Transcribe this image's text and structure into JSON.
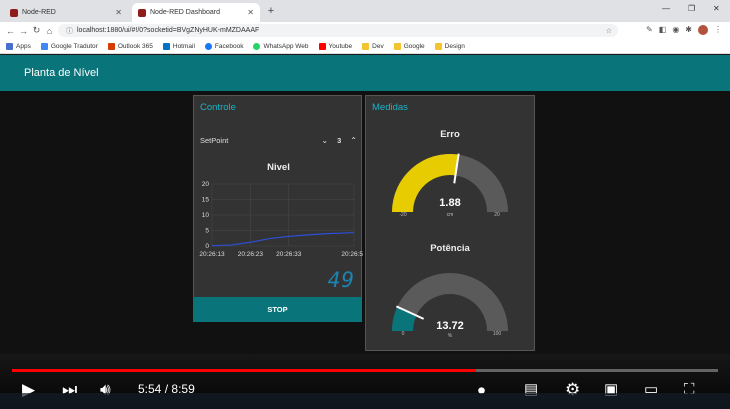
{
  "browser": {
    "tabs": [
      {
        "title": "Node-RED",
        "close": "✕"
      },
      {
        "title": "Node-RED Dashboard",
        "close": "✕"
      }
    ],
    "new_tab": "+",
    "window_controls": [
      "—",
      "❐",
      "✕"
    ],
    "url": "localhost:1880/ui/#!/0?socketid=BVgZNyHUK-mMZDAAAF",
    "bookmarks": [
      {
        "label": "Apps",
        "color": "#4a6fd1"
      },
      {
        "label": "Google Tradutor",
        "color": "#4285f4"
      },
      {
        "label": "Outlook 365",
        "color": "#d83b01"
      },
      {
        "label": "Hotmail",
        "color": "#0072c6"
      },
      {
        "label": "Facebook",
        "color": "#1877f2"
      },
      {
        "label": "WhatsApp Web",
        "color": "#25d366"
      },
      {
        "label": "Youtube",
        "color": "#ff0000"
      },
      {
        "label": "Dev",
        "color": "#f4c430"
      },
      {
        "label": "Google",
        "color": "#f4c430"
      },
      {
        "label": "Design",
        "color": "#f4c430"
      }
    ]
  },
  "dashboard": {
    "header_title": "Planta de Nível",
    "controle": {
      "title": "Controle",
      "setpoint_label": "SetPoint",
      "setpoint_value": "3",
      "down_icon": "⌄",
      "up_icon": "⌃",
      "stop_label": "STOP"
    },
    "medidas": {
      "title": "Medidas",
      "erro": {
        "title": "Erro",
        "value": "1.88",
        "units": "cm",
        "min": "-20",
        "max": "20",
        "color": "#e6cc00"
      },
      "potencia": {
        "title": "Potência",
        "value": "13.72",
        "units": "%",
        "min": "0",
        "max": "100",
        "color": "#097479"
      }
    },
    "lcd_display": "49"
  },
  "chart_data": {
    "type": "line",
    "title": "Nivel",
    "xlabel": "",
    "ylabel": "",
    "ylim": [
      0,
      20
    ],
    "y_ticks": [
      "20",
      "15",
      "10",
      "5",
      "0"
    ],
    "x_ticks": [
      "20:26:13",
      "20:26:23",
      "20:26:33",
      "20:26:50"
    ],
    "series": [
      {
        "color": "#2b4fd6",
        "x": [
          "20:26:13",
          "20:26:18",
          "20:26:23",
          "20:26:28",
          "20:26:33",
          "20:26:38",
          "20:26:43",
          "20:26:50"
        ],
        "values": [
          0.1,
          0.3,
          1.2,
          2.4,
          3.1,
          3.6,
          4.0,
          4.3
        ]
      }
    ],
    "grid": true
  },
  "player": {
    "current_time": "5:54",
    "duration": "8:59",
    "progress": 0.657,
    "time_separator": "/"
  }
}
